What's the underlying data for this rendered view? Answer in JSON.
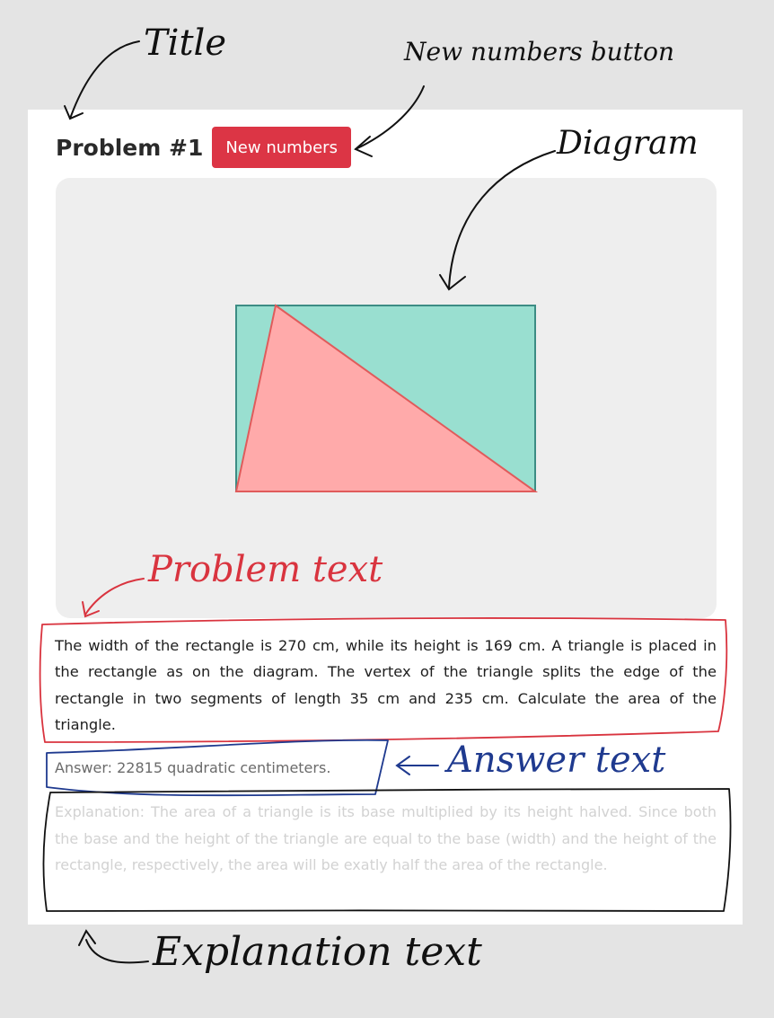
{
  "problem": {
    "title": "Problem #1",
    "new_numbers_label": "New numbers",
    "text": "The width of the rectangle is 270 cm, while its height is 169 cm. A triangle is placed in the rectangle as on the diagram. The vertex of the triangle splits the edge of the rectangle in two segments of length 35 cm and 235 cm. Calculate the area of the triangle.",
    "answer": "Answer: 22815 quadratic centimeters.",
    "explanation": "Explanation: The area of a triangle is its base multiplied by its height halved. Since both the base and the height of the triangle are equal to the base (width) and the height of the rectangle, respectively, the area will be exatly half the area of the rectangle."
  },
  "diagram": {
    "rectangle_fill": "#99dfd0",
    "rectangle_stroke": "#3c8c84",
    "triangle_fill": "#ffaaaa",
    "triangle_stroke": "#e05b5b"
  },
  "annotations": {
    "title_label": "Title",
    "new_numbers_button_label": "New numbers button",
    "diagram_label": "Diagram",
    "problem_text_label": "Problem text",
    "answer_text_label": "Answer text",
    "explanation_text_label": "Explanation text",
    "ink_color": "#111111",
    "problem_ink_color": "#d9343f",
    "answer_ink_color": "#1f3a8f"
  }
}
